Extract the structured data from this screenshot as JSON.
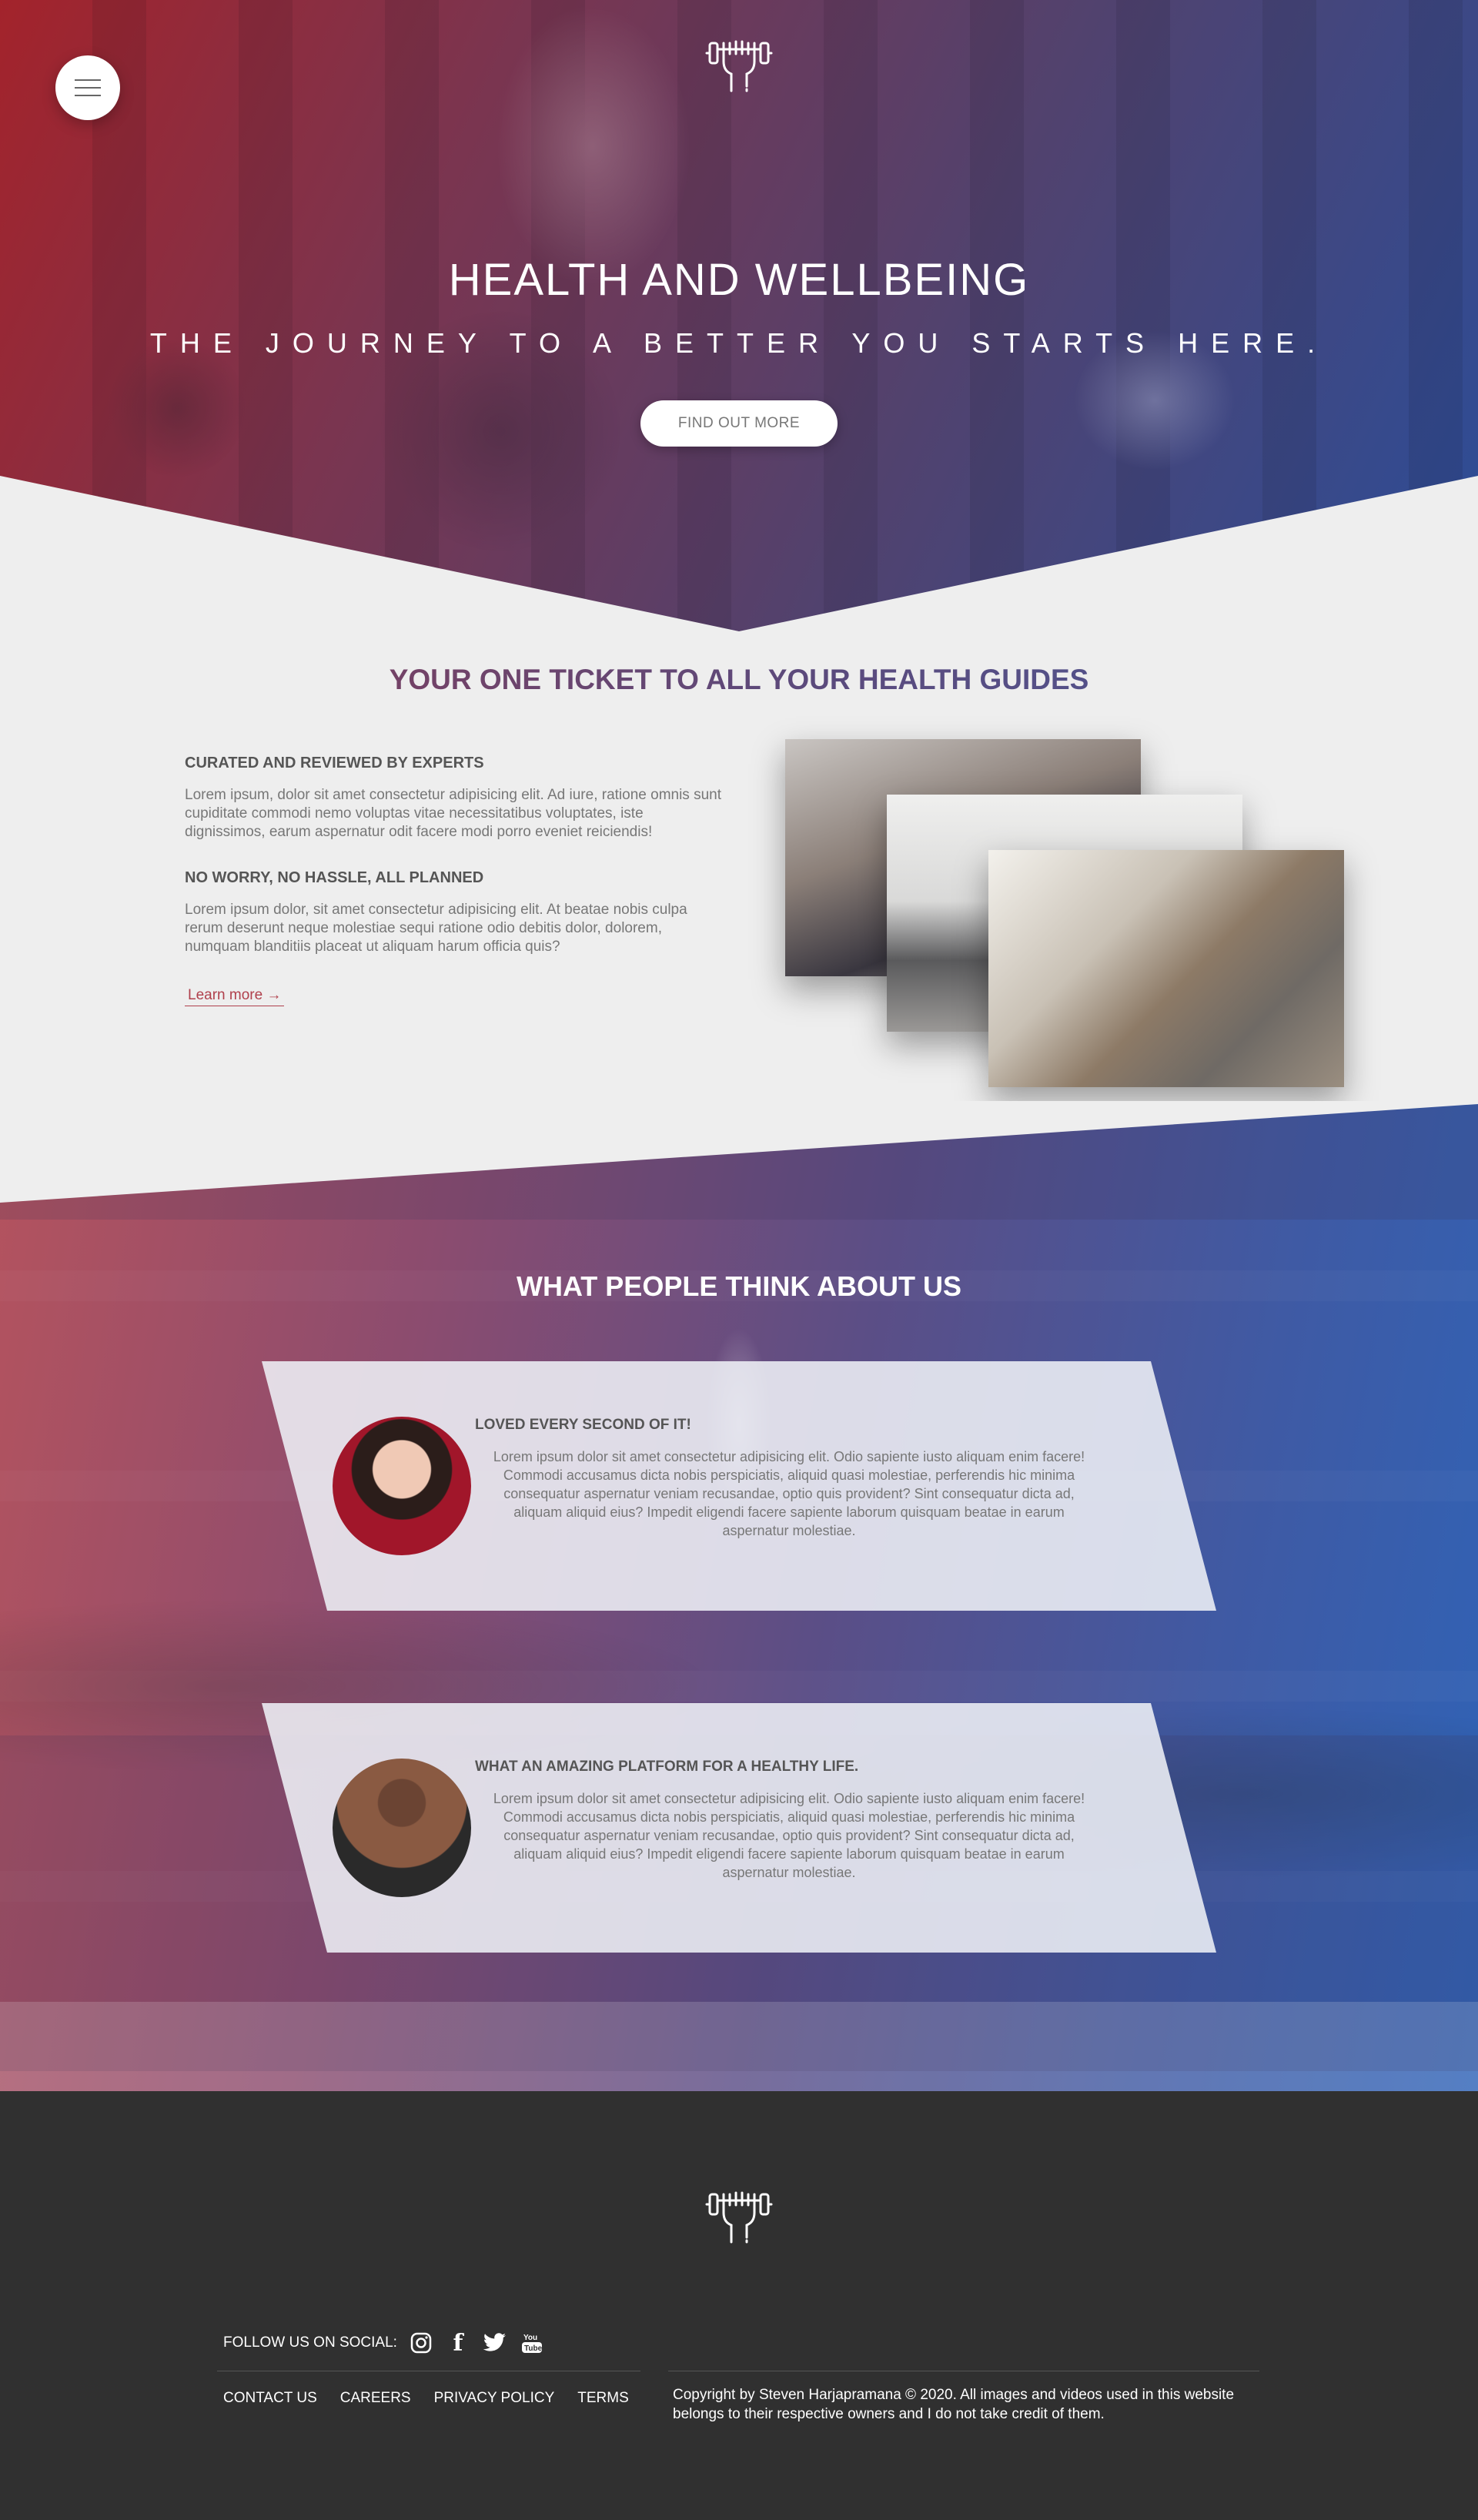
{
  "hero": {
    "title": "HEALTH AND WELLBEING",
    "subtitle": "THE JOURNEY TO A BETTER YOU STARTS HERE.",
    "cta_label": "FIND OUT MORE"
  },
  "about": {
    "title": "YOUR ONE TICKET TO ALL YOUR HEALTH GUIDES",
    "features": [
      {
        "heading": "CURATED AND REVIEWED BY EXPERTS",
        "body": "Lorem ipsum, dolor sit amet consectetur adipisicing elit. Ad iure, ratione omnis sunt cupiditate commodi nemo voluptas vitae necessitatibus voluptates, iste dignissimos, earum aspernatur odit facere modi porro eveniet reiciendis!"
      },
      {
        "heading": "NO WORRY, NO HASSLE, ALL PLANNED",
        "body": "Lorem ipsum dolor, sit amet consectetur adipisicing elit. At beatae nobis culpa rerum deserunt neque molestiae sequi ratione odio debitis dolor, dolorem, numquam blanditiis placeat ut aliquam harum officia quis?"
      }
    ],
    "learn_more": "Learn more →"
  },
  "testimonials": {
    "title": "WHAT PEOPLE THINK ABOUT US",
    "items": [
      {
        "heading": "LOVED EVERY SECOND OF IT!",
        "body": "Lorem ipsum dolor sit amet consectetur adipisicing elit. Odio sapiente iusto aliquam enim facere! Commodi accusamus dicta nobis perspiciatis, aliquid quasi molestiae, perferendis hic minima consequatur aspernatur veniam recusandae, optio quis provident? Sint consequatur dicta ad, aliquam aliquid eius? Impedit eligendi facere sapiente laborum quisquam beatae in earum aspernatur molestiae."
      },
      {
        "heading": "WHAT AN AMAZING PLATFORM FOR A HEALTHY LIFE.",
        "body": "Lorem ipsum dolor sit amet consectetur adipisicing elit. Odio sapiente iusto aliquam enim facere! Commodi accusamus dicta nobis perspiciatis, aliquid quasi molestiae, perferendis hic minima consequatur aspernatur veniam recusandae, optio quis provident? Sint consequatur dicta ad, aliquam aliquid eius? Impedit eligendi facere sapiente laborum quisquam beatae in earum aspernatur molestiae."
      }
    ]
  },
  "footer": {
    "follow_label": "FOLLOW US ON SOCIAL:",
    "social_icons": [
      "instagram-icon",
      "facebook-icon",
      "twitter-icon",
      "youtube-icon"
    ],
    "facebook_glyph": "f",
    "links": [
      "CONTACT US",
      "CAREERS",
      "PRIVACY POLICY",
      "TERMS"
    ],
    "copyright": "Copyright by Steven Harjapramana © 2020. All images and videos used in this website belongs to their respective owners and I do not take credit of them."
  },
  "colors": {
    "hero_red": "#a3232b",
    "hero_blue": "#2c4d98",
    "accent_link": "#b0404c",
    "page_bg": "#eeeeee",
    "footer_bg": "#303030"
  }
}
